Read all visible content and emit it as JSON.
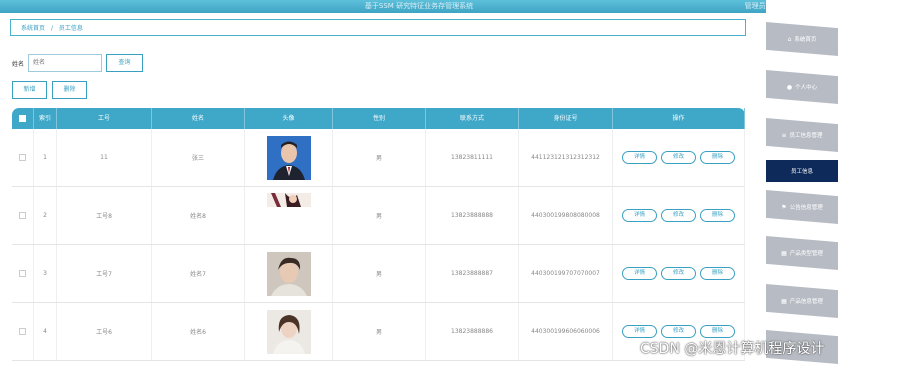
{
  "topbar": {
    "title": "基于SSM 研究特征业务存管理系统",
    "user": "管理员 admin  退出登录"
  },
  "breadcrumb": {
    "home": "系统首页",
    "sep": "/",
    "current": "员工信息"
  },
  "search": {
    "label": "姓名",
    "placeholder": "姓名",
    "button": "查询"
  },
  "ops": {
    "add": "新增",
    "delete": "删除"
  },
  "table": {
    "headers": [
      "",
      "索引",
      "工号",
      "姓名",
      "头像",
      "性别",
      "联系方式",
      "身份证号",
      "操作"
    ],
    "rows": [
      {
        "index": "1",
        "job_no": "11",
        "name": "张三",
        "gender": "男",
        "phone": "13823811111",
        "id_card": "441123121312312312"
      },
      {
        "index": "2",
        "job_no": "工号8",
        "name": "姓名8",
        "gender": "男",
        "phone": "13823888888",
        "id_card": "440300199808080008"
      },
      {
        "index": "3",
        "job_no": "工号7",
        "name": "姓名7",
        "gender": "男",
        "phone": "13823888887",
        "id_card": "440300199707070007"
      },
      {
        "index": "4",
        "job_no": "工号6",
        "name": "姓名6",
        "gender": "男",
        "phone": "13823888886",
        "id_card": "440300199606060006"
      }
    ],
    "actions": {
      "detail": "详情",
      "edit": "修改",
      "delete": "删除"
    }
  },
  "sidebar": {
    "items": [
      {
        "label": "系统首页",
        "icon": "home-icon"
      },
      {
        "label": "个人中心",
        "icon": "user-icon"
      },
      {
        "label": "员工信息管理",
        "icon": "list-icon"
      },
      {
        "label": "员工信息",
        "icon": "",
        "active": true
      },
      {
        "label": "公告信息管理",
        "icon": "flag-icon"
      },
      {
        "label": "产品类型管理",
        "icon": "grid-icon"
      },
      {
        "label": "产品信息管理",
        "icon": "grid-icon"
      }
    ]
  },
  "watermark": "CSDN @米恩计算机程序设计",
  "colors": {
    "accent": "#3fa8c9",
    "sidebar_active": "#0e2a5a",
    "sidebar_item": "#b7bcc4"
  }
}
